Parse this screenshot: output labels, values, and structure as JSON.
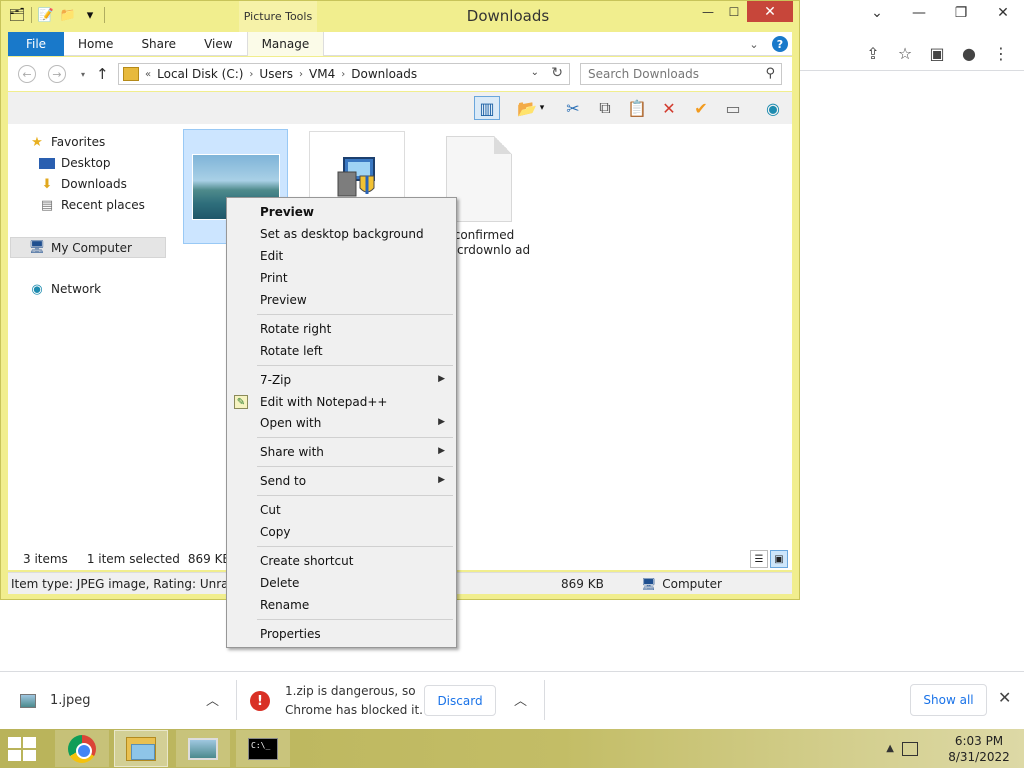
{
  "chrome": {
    "controls": {
      "minimize": "⌄",
      "minimize2": "—",
      "restore": "❐",
      "close": "✕"
    },
    "toolbar_icons": [
      "share-icon",
      "star-icon",
      "sidebar-icon",
      "profile-icon",
      "menu-icon"
    ]
  },
  "explorer": {
    "picture_tools": "Picture Tools",
    "title": "Downloads",
    "window_controls": {
      "minimize": "—",
      "maximize": "☐",
      "close": "✕"
    },
    "tabs": {
      "file": "File",
      "home": "Home",
      "share": "Share",
      "view": "View",
      "manage": "Manage"
    },
    "address": {
      "crumbs": [
        "Local Disk (C:)",
        "Users",
        "VM4",
        "Downloads"
      ],
      "overflow": "«"
    },
    "search": {
      "placeholder": "Search Downloads"
    },
    "nav": {
      "favorites": "Favorites",
      "desktop": "Desktop",
      "downloads": "Downloads",
      "recent": "Recent places",
      "computer": "My Computer",
      "network": "Network"
    },
    "files": {
      "file3_label": "confirmed 16.crdownlo ad"
    },
    "status": {
      "items": "3 items",
      "selected": "1 item selected",
      "size": "869 KB"
    },
    "details": {
      "item_type": "Item type: JPEG image, Rating: Unrated, S",
      "size": "869 KB",
      "location": "Computer"
    }
  },
  "context_menu": {
    "preview_default": "Preview",
    "set_background": "Set as desktop background",
    "edit": "Edit",
    "print": "Print",
    "preview": "Preview",
    "rotate_right": "Rotate right",
    "rotate_left": "Rotate left",
    "zip": "7-Zip",
    "notepad": "Edit with Notepad++",
    "open_with": "Open with",
    "share_with": "Share with",
    "send_to": "Send to",
    "cut": "Cut",
    "copy": "Copy",
    "create_shortcut": "Create shortcut",
    "delete": "Delete",
    "rename": "Rename",
    "properties": "Properties"
  },
  "download_bar": {
    "file1": "1.jpeg",
    "warning": "1.zip is dangerous, so Chrome has blocked it.",
    "discard": "Discard",
    "show_all": "Show all"
  },
  "taskbar": {
    "time": "6:03 PM",
    "date": "8/31/2022",
    "cmd_prompt": "C:\\_"
  },
  "colors": {
    "explorer_frame": "#f1ee8e",
    "file_tab": "#1979ca",
    "close_button": "#c7463a",
    "chrome_blue": "#1a73e8",
    "warning_red": "#d93025"
  }
}
